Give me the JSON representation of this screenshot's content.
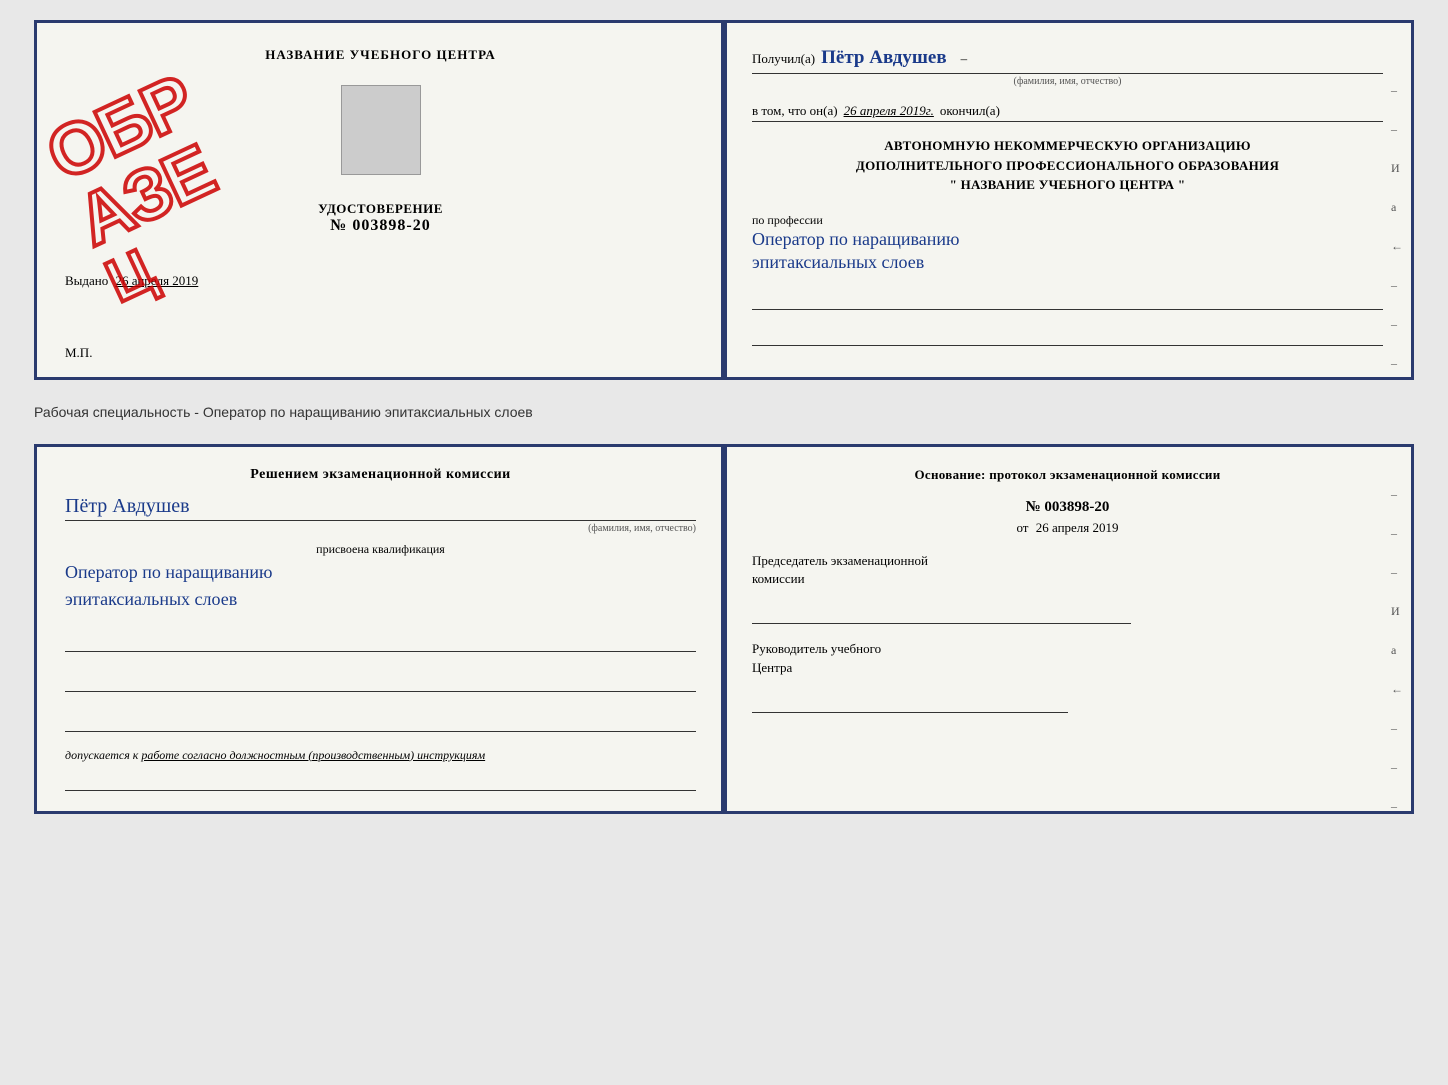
{
  "page": {
    "background_color": "#e8e8e8"
  },
  "separator": {
    "text": "Рабочая специальность - Оператор по наращиванию эпитаксиальных слоев"
  },
  "top_cert": {
    "left": {
      "title": "НАЗВАНИЕ УЧЕБНОГО ЦЕНТРА",
      "stamp_text": "ОБРАЗЕЦ",
      "udost_title": "УДОСТОВЕРЕНИЕ",
      "udost_number": "№ 003898-20",
      "vidano_label": "Выдано",
      "vidano_date": "26 апреля 2019",
      "mp": "М.П."
    },
    "right": {
      "poluchil_label": "Получил(а)",
      "poluchil_name": "Пётр Авдушев",
      "fio_label": "(фамилия, имя, отчество)",
      "dash1": "–",
      "vtom_label": "в том, что он(а)",
      "vtom_date": "26 апреля 2019г.",
      "okonchil_label": "окончил(а)",
      "org_line1": "АВТОНОМНУЮ НЕКОММЕРЧЕСКУЮ ОРГАНИЗАЦИЮ",
      "org_line2": "ДОПОЛНИТЕЛЬНОГО ПРОФЕССИОНАЛЬНОГО ОБРАЗОВАНИЯ",
      "org_line3": "\"   НАЗВАНИЕ УЧЕБНОГО ЦЕНТРА   \"",
      "po_professii_label": "по профессии",
      "profession_line1": "Оператор по наращиванию",
      "profession_line2": "эпитаксиальных слоев",
      "dashes": [
        "–",
        "–",
        "И",
        "а",
        "←",
        "–",
        "–",
        "–"
      ]
    }
  },
  "bottom_cert": {
    "left": {
      "resheniem_title": "Решением экзаменационной комиссии",
      "fio_name": "Пётр Авдушев",
      "fio_label": "(фамилия, имя, отчество)",
      "prisvoena_label": "присвоена квалификация",
      "qualification_line1": "Оператор по наращиванию",
      "qualification_line2": "эпитаксиальных слоев",
      "dopuskaetsya_prefix": "допускается к",
      "dopuskaetsya_text": "работе согласно должностным (производственным) инструкциям"
    },
    "right": {
      "osnovanie_title": "Основание: протокол экзаменационной комиссии",
      "protocol_number": "№  003898-20",
      "ot_label": "от",
      "ot_date": "26 апреля 2019",
      "chairman_label_line1": "Председатель экзаменационной",
      "chairman_label_line2": "комиссии",
      "rukovoditel_label_line1": "Руководитель учебного",
      "rukovoditel_label_line2": "Центра",
      "dashes": [
        "–",
        "–",
        "–",
        "И",
        "а",
        "←",
        "–",
        "–",
        "–"
      ]
    }
  }
}
